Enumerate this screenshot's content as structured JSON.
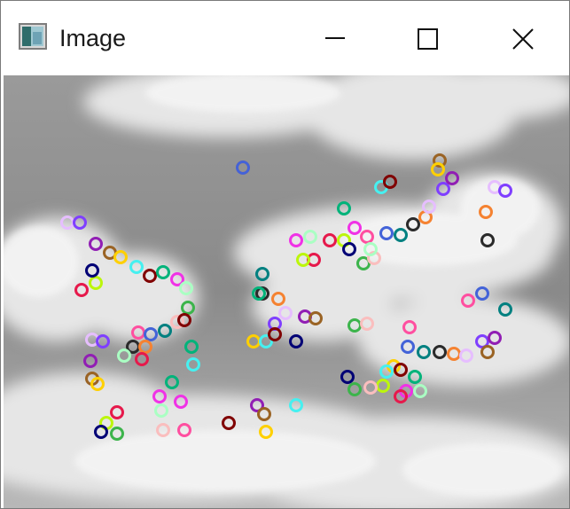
{
  "window": {
    "title": "Image",
    "icon": "image-window-icon",
    "controls": {
      "minimize": "minimize-icon",
      "maximize": "maximize-icon",
      "close": "close-icon"
    }
  },
  "content": {
    "description_icon": "grayscale-cloud-photo-with-keypoint-circles",
    "keypoint_colors": [
      "#e6194b",
      "#3cb44b",
      "#4363d8",
      "#f58231",
      "#911eb4",
      "#46f0f0",
      "#f032e6",
      "#bcf60c",
      "#fabebe",
      "#008080",
      "#e6beff",
      "#9a6324",
      "#800000",
      "#aaffc3",
      "#000075",
      "#ff4fa0",
      "#2a2a2a",
      "#7f3fff",
      "#ffd000",
      "#00b37a"
    ]
  }
}
